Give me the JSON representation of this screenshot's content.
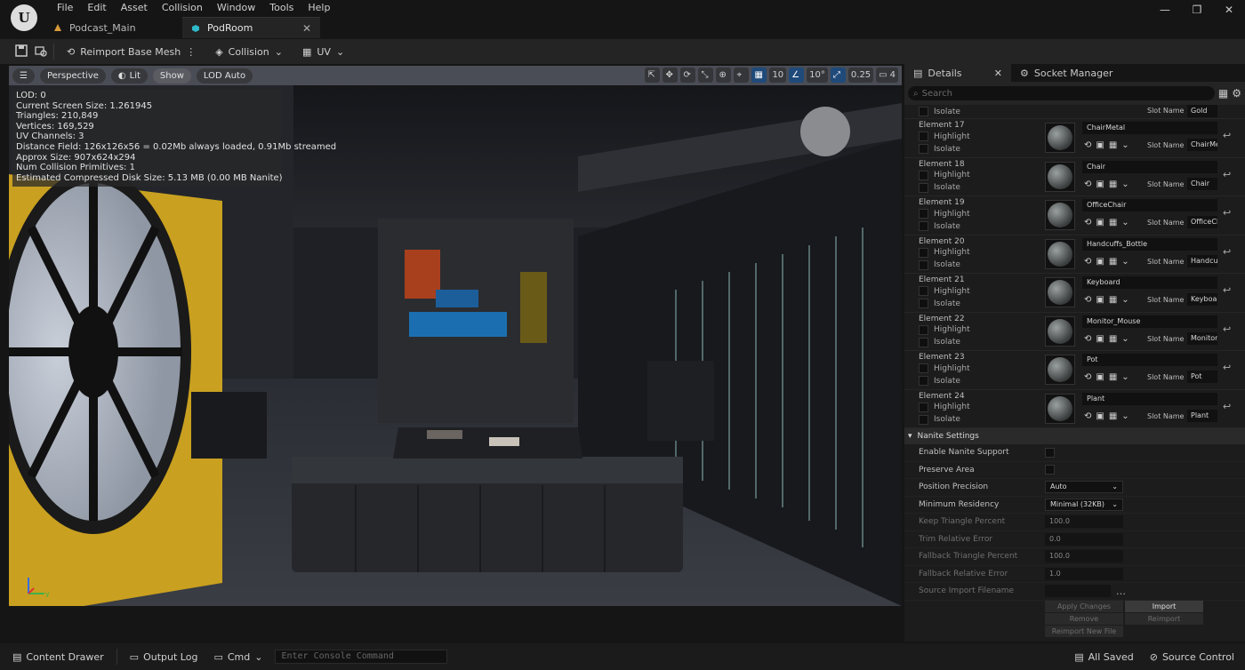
{
  "menu": [
    "File",
    "Edit",
    "Asset",
    "Collision",
    "Window",
    "Tools",
    "Help"
  ],
  "tabs": [
    {
      "label": "Podcast_Main",
      "icon": "level-icon"
    },
    {
      "label": "PodRoom",
      "icon": "static-mesh-icon"
    }
  ],
  "toolbar": {
    "reimport": "Reimport Base Mesh",
    "collision": "Collision",
    "uv": "UV"
  },
  "viewport": {
    "perspective": "Perspective",
    "lit": "Lit",
    "show": "Show",
    "lod": "LOD Auto",
    "grid_snap": "10",
    "rot_snap": "10°",
    "scale_snap": "0.25",
    "cam_speed": "4"
  },
  "stats": [
    "LOD:  0",
    "Current Screen Size:  1.261945",
    "Triangles:  210,849",
    "Vertices:  169,529",
    "UV Channels:  3",
    "Distance Field:  126x126x56 = 0.02Mb always loaded, 0.91Mb streamed",
    "Approx Size: 907x624x294",
    "Num Collision Primitives:  1",
    "Estimated Compressed Disk Size: 5.13 MB (0.00 MB Nanite)"
  ],
  "details": {
    "tab": "Details",
    "socket_tab": "Socket Manager",
    "search_placeholder": "Search",
    "highlight": "Highlight",
    "isolate": "Isolate",
    "slot_name_label": "Slot Name",
    "top_partial": {
      "isolate": "Isolate",
      "slot": "Gold"
    },
    "elements": [
      {
        "name": "Element 17",
        "material": "ChairMetal",
        "slot": "ChairMe"
      },
      {
        "name": "Element 18",
        "material": "Chair",
        "slot": "Chair"
      },
      {
        "name": "Element 19",
        "material": "OfficeChair",
        "slot": "OfficeCh"
      },
      {
        "name": "Element 20",
        "material": "Handcuffs_Bottle",
        "slot": "Handcuf"
      },
      {
        "name": "Element 21",
        "material": "Keyboard",
        "slot": "Keyboar"
      },
      {
        "name": "Element 22",
        "material": "Monitor_Mouse",
        "slot": "MonitorR"
      },
      {
        "name": "Element 23",
        "material": "Pot",
        "slot": "Pot"
      },
      {
        "name": "Element 24",
        "material": "Plant",
        "slot": "Plant"
      }
    ],
    "nanite": {
      "section": "Nanite Settings",
      "enable": "Enable Nanite Support",
      "preserve": "Preserve Area",
      "precision_label": "Position Precision",
      "precision_value": "Auto",
      "residency_label": "Minimum Residency",
      "residency_value": "Minimal (32KB)",
      "keep_label": "Keep Triangle Percent",
      "keep_value": "100.0",
      "trim_label": "Trim Relative Error",
      "trim_value": "0.0",
      "fallback_pct_label": "Fallback Triangle Percent",
      "fallback_pct_value": "100.0",
      "fallback_err_label": "Fallback Relative Error",
      "fallback_err_value": "1.0",
      "source_label": "Source Import Filename",
      "apply": "Apply Changes",
      "import": "Import",
      "remove": "Remove",
      "reimport": "Reimport",
      "reimport_new": "Reimport New File"
    }
  },
  "statusbar": {
    "content_drawer": "Content Drawer",
    "output_log": "Output Log",
    "cmd": "Cmd",
    "console_placeholder": "Enter Console Command",
    "all_saved": "All Saved",
    "source_control": "Source Control"
  }
}
